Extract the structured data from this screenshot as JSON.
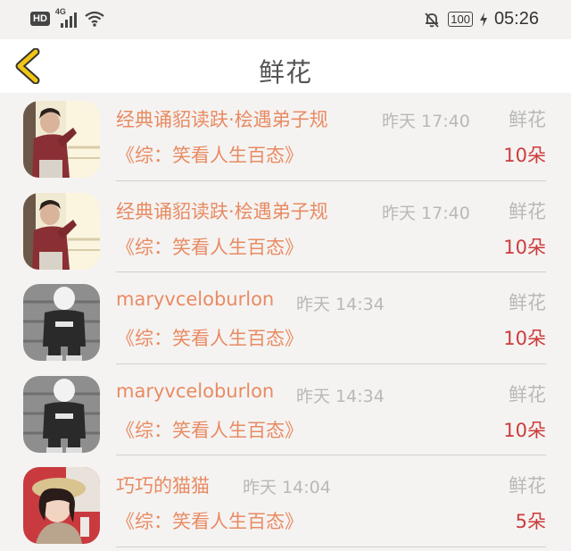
{
  "status_bar": {
    "hd": "HD",
    "network": "4G",
    "battery": "100",
    "time": "05:26"
  },
  "header": {
    "title": "鲜花",
    "back_icon": "chevron-left-icon",
    "accent_color": "#f0c514"
  },
  "colors": {
    "name": "#e88b63",
    "count": "#cc3b3b",
    "muted": "#b8b8b8"
  },
  "items": [
    {
      "name": "经典诵貂读趺·桧遇弟子规",
      "time": "昨天 17:40",
      "gift": "鲜花",
      "show": "《综：笑看人生百态》",
      "count": "10朵"
    },
    {
      "name": "经典诵貂读趺·桧遇弟子规",
      "time": "昨天 17:40",
      "gift": "鲜花",
      "show": "《综：笑看人生百态》",
      "count": "10朵"
    },
    {
      "name": "maryvceloburlon",
      "time": "昨天 14:34",
      "gift": "鲜花",
      "show": "《综：笑看人生百态》",
      "count": "10朵"
    },
    {
      "name": "maryvceloburlon",
      "time": "昨天 14:34",
      "gift": "鲜花",
      "show": "《综：笑看人生百态》",
      "count": "10朵"
    },
    {
      "name": "巧巧的猫猫",
      "time": "昨天 14:04",
      "gift": "鲜花",
      "show": "《综：笑看人生百态》",
      "count": "5朵"
    }
  ]
}
